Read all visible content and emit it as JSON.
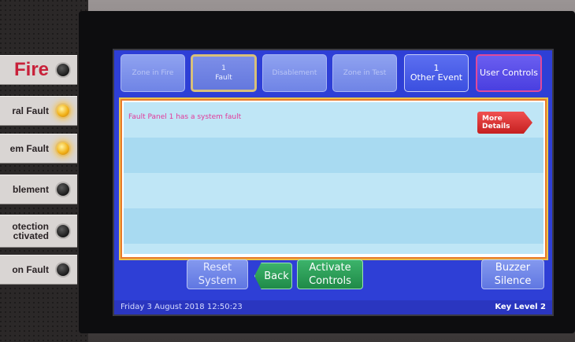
{
  "indicators": [
    {
      "label": "Fire",
      "led": "off"
    },
    {
      "label": "ral Fault",
      "led": "on"
    },
    {
      "label": "em Fault",
      "led": "on"
    },
    {
      "label": "blement",
      "led": "off"
    },
    {
      "label": "otection\nctivated",
      "led": "off"
    },
    {
      "label": "on Fault",
      "led": "off"
    }
  ],
  "tabs": [
    {
      "count": "",
      "label": "Zone in Fire",
      "state": "dim"
    },
    {
      "count": "1",
      "label": "Fault",
      "state": "active"
    },
    {
      "count": "",
      "label": "Disablement",
      "state": "dim"
    },
    {
      "count": "",
      "label": "Zone in Test",
      "state": "dim"
    },
    {
      "count": "1",
      "label": "Other Event",
      "state": "bright"
    },
    {
      "count": "",
      "label": "User Controls",
      "state": "user"
    }
  ],
  "event_list": {
    "message": "Fault Panel 1 has a system fault",
    "more_details": "More Details"
  },
  "buttons": {
    "reset_system": "Reset\nSystem",
    "back": "Back",
    "activate_controls": "Activate\nControls",
    "buzzer_silence": "Buzzer\nSilence"
  },
  "status": {
    "datetime": "Friday 3 August 2018 12:50:23",
    "key_level": "Key Level 2"
  },
  "colors": {
    "screen_bg": "#2e3fd6",
    "fault_text": "#e2389a",
    "led_on": "#f2b21a",
    "fire_label": "#c8213a"
  }
}
